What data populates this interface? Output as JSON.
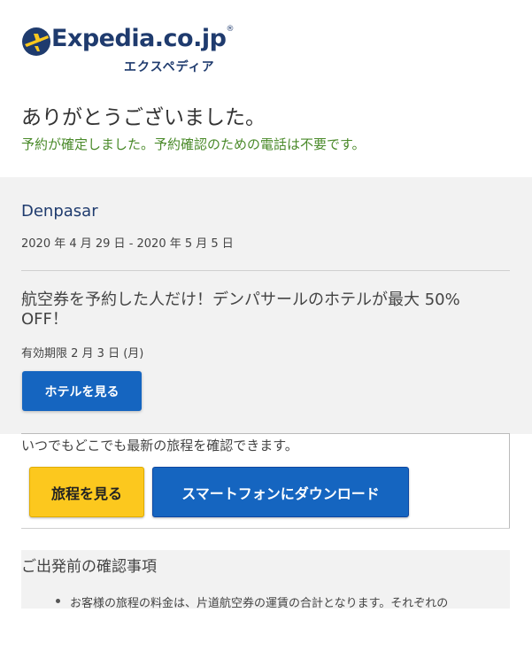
{
  "brand": {
    "name": "Expedia.co.jp",
    "trademark": "®",
    "subtitle": "エクスペディア",
    "logo_color": "#1f3b6e",
    "logo_accent": "#fcc81e"
  },
  "thanks_heading": "ありがとうございました。",
  "confirmation_message": "予約が確定しました。予約確認のための電話は不要です。",
  "trip": {
    "destination": "Denpasar",
    "dates": "2020 年 4 月 29 日 - 2020 年 5 月 5 日"
  },
  "promo": {
    "text": "航空券を予約した人だけ！デンパサールのホテルが最大 50% OFF！",
    "expiry": "有効期限 2 月 3 日 (月)",
    "button_label": "ホテルを見る"
  },
  "itinerary": {
    "note": "いつでもどこでも最新の旅程を確認できます。",
    "view_button": "旅程を見る",
    "download_button": "スマートフォンにダウンロード"
  },
  "checklist": {
    "title": "ご出発前の確認事項",
    "items": [
      "お客様の旅程の料金は、片道航空券の運賃の合計となります。それぞれの"
    ]
  },
  "colors": {
    "primary_blue": "#1565c0",
    "accent_yellow": "#fcc81e",
    "success_green": "#4a8a2a",
    "panel_gray": "#f2f2f2"
  }
}
